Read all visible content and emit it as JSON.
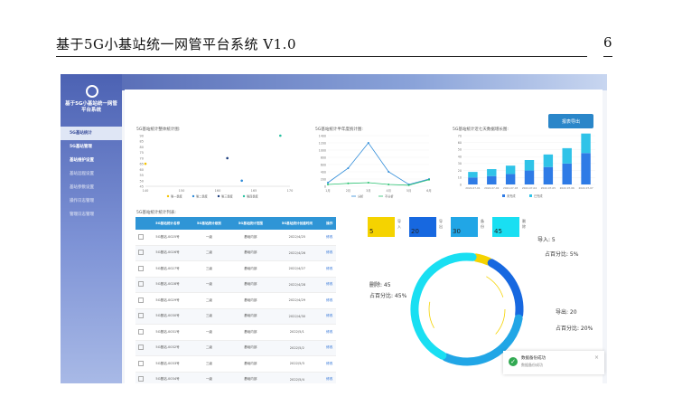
{
  "document": {
    "title": "基于5G小基站统一网管平台系统 V1.0",
    "page": "6"
  },
  "sidebar": {
    "title": "基于5G小基站统一网管平台系统",
    "items": [
      {
        "label": "5G基站统计"
      },
      {
        "label": "5G基站管理"
      },
      {
        "label": "基站维护设置"
      },
      {
        "label": "基站远程设置"
      },
      {
        "label": "基站参数设置"
      },
      {
        "label": "操作日志管理"
      },
      {
        "label": "管理日志管理"
      }
    ]
  },
  "toolbar": {
    "export_label": "报表导出"
  },
  "panels": {
    "scatter_title": "5G基站统计整体统计图:",
    "line_title": "5G基站统计半年度统计图:",
    "bar_title": "5G基站统计近七天数据增长图:",
    "table_title": "5G基站统计统计列表:"
  },
  "table": {
    "headers": [
      "5G基站统计名称",
      "5G基站统计级别",
      "5G基站统计范围",
      "5G基站统计创建时间",
      "操作"
    ],
    "rows": [
      [
        "5G基站-0025号",
        "一级",
        "基础内部",
        "2022/4/25",
        "修改"
      ],
      [
        "5G基站-0026号",
        "二级",
        "基础内部",
        "2022/4/26",
        "修改"
      ],
      [
        "5G基站-0027号",
        "三级",
        "基础内部",
        "2022/4/27",
        "修改"
      ],
      [
        "5G基站-0028号",
        "一级",
        "基础内部",
        "2022/4/28",
        "修改"
      ],
      [
        "5G基站-0029号",
        "二级",
        "基础内部",
        "2022/4/29",
        "修改"
      ],
      [
        "5G基站-0030号",
        "三级",
        "基础内部",
        "2022/4/30",
        "修改"
      ],
      [
        "5G基站-0031号",
        "一级",
        "基础内部",
        "2022/5/1",
        "修改"
      ],
      [
        "5G基站-0032号",
        "二级",
        "基础内部",
        "2022/5/2",
        "修改"
      ],
      [
        "5G基站-0033号",
        "三级",
        "基础内部",
        "2022/5/3",
        "修改"
      ],
      [
        "5G基站-0034号",
        "一级",
        "基础内部",
        "2022/5/4",
        "修改"
      ]
    ]
  },
  "stats": [
    {
      "name": "导入",
      "value": "5",
      "color": "#f5d300"
    },
    {
      "name": "导出",
      "value": "20",
      "color": "#1768e0"
    },
    {
      "name": "备份",
      "value": "30",
      "color": "#21a6e6"
    },
    {
      "name": "删除",
      "value": "45",
      "color": "#19dff2"
    }
  ],
  "donut_labels": {
    "import": "导入: 5",
    "import_pct": "占百分比: 5%",
    "export": "导出: 20",
    "export_pct": "占百分比: 20%",
    "delete": "删除: 45",
    "delete_pct": "占百分比: 45%"
  },
  "toast": {
    "title": "数据备份成功",
    "sub": "数据备份成功"
  },
  "chart_data": [
    {
      "type": "scatter",
      "title": "5G基站统计整体统计图:",
      "series": [
        {
          "name": "第一季度",
          "x": [
            140
          ],
          "y": [
            65
          ],
          "color": "#f5c300"
        },
        {
          "name": "第二季度",
          "x": [
            160
          ],
          "y": [
            50
          ],
          "color": "#2e8bd8"
        },
        {
          "name": "第三季度",
          "x": [
            157
          ],
          "y": [
            70
          ],
          "color": "#1a3c7d"
        },
        {
          "name": "第四季度",
          "x": [
            168
          ],
          "y": [
            90
          ],
          "color": "#28c0a0"
        }
      ],
      "xticks": [
        "140",
        "150",
        "160",
        "165",
        "170"
      ],
      "yticks": [
        "90",
        "85",
        "80",
        "75",
        "70",
        "65",
        "60",
        "55",
        "50",
        "45"
      ]
    },
    {
      "type": "line",
      "title": "5G基站统计半年度统计图:",
      "categories": [
        "1月",
        "2月",
        "3月",
        "4月",
        "5月",
        "6月"
      ],
      "series": [
        {
          "name": "分析",
          "values": [
            100,
            500,
            1200,
            400,
            50,
            200
          ],
          "color": "#2e8bd8"
        },
        {
          "name": "不分析",
          "values": [
            50,
            80,
            100,
            50,
            30,
            180
          ],
          "color": "#28c070"
        }
      ],
      "yticks": [
        "1400",
        "1200",
        "1000",
        "800",
        "600",
        "400",
        "200",
        "0"
      ]
    },
    {
      "type": "bar",
      "title": "5G基站统计近七天数据增长图:",
      "categories": [
        "2022-07-01",
        "2022-07-02",
        "2022-07-03",
        "2022-07-04",
        "2022-07-05",
        "2022-07-06",
        "2022-07-07"
      ],
      "series": [
        {
          "name": "未完成",
          "values": [
            10,
            12,
            15,
            20,
            25,
            30,
            45
          ],
          "color": "#2e7be6"
        },
        {
          "name": "已完成",
          "values": [
            8,
            10,
            12,
            15,
            18,
            22,
            28
          ],
          "color": "#2fc3e8"
        }
      ],
      "yticks": [
        "70",
        "60",
        "50",
        "40",
        "30",
        "20",
        "10",
        "0"
      ]
    }
  ]
}
